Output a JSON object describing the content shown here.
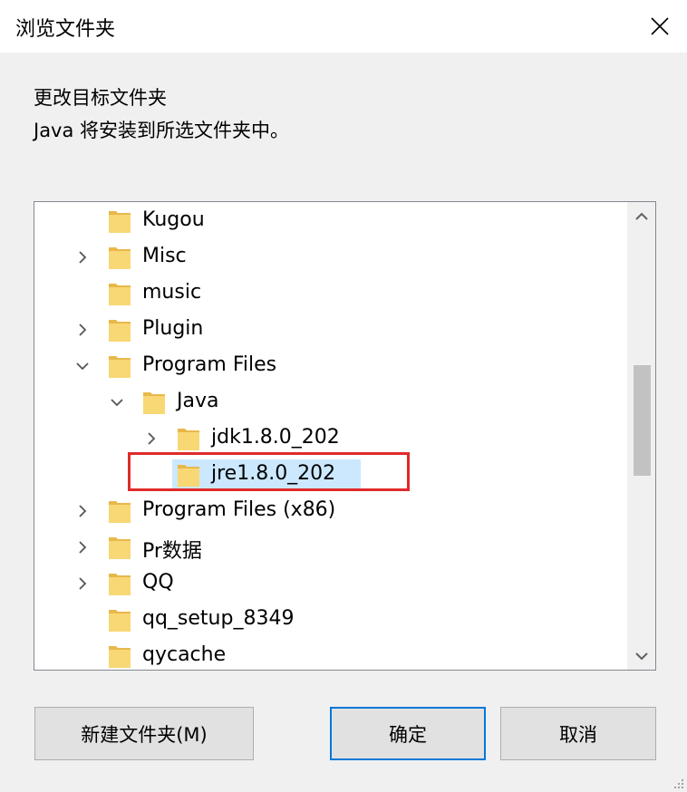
{
  "dialog": {
    "title": "浏览文件夹",
    "description_line1": "更改目标文件夹",
    "description_line2": "Java 将安装到所选文件夹中。"
  },
  "tree": {
    "items": [
      {
        "label": "Kugou",
        "level": 0,
        "expander": "none"
      },
      {
        "label": "Misc",
        "level": 0,
        "expander": "collapsed"
      },
      {
        "label": "music",
        "level": 0,
        "expander": "none"
      },
      {
        "label": "Plugin",
        "level": 0,
        "expander": "collapsed"
      },
      {
        "label": "Program Files",
        "level": 0,
        "expander": "expanded"
      },
      {
        "label": "Java",
        "level": 1,
        "expander": "expanded"
      },
      {
        "label": "jdk1.8.0_202",
        "level": 2,
        "expander": "collapsed"
      },
      {
        "label": "jre1.8.0_202",
        "level": 2,
        "expander": "none",
        "selected": true
      },
      {
        "label": "Program Files (x86)",
        "level": 0,
        "expander": "collapsed"
      },
      {
        "label": "Pr数据",
        "level": 0,
        "expander": "collapsed"
      },
      {
        "label": "QQ",
        "level": 0,
        "expander": "collapsed"
      },
      {
        "label": "qq_setup_8349",
        "level": 0,
        "expander": "none"
      },
      {
        "label": "qycache",
        "level": 0,
        "expander": "none"
      }
    ],
    "scroll_position": 0.45
  },
  "buttons": {
    "new_folder": "新建文件夹(M)",
    "ok": "确定",
    "cancel": "取消"
  },
  "colors": {
    "selection": "#cce8ff",
    "annotation_box": "#e02a2a",
    "folder": "#f8d775",
    "default_button_border": "#0078d7"
  }
}
